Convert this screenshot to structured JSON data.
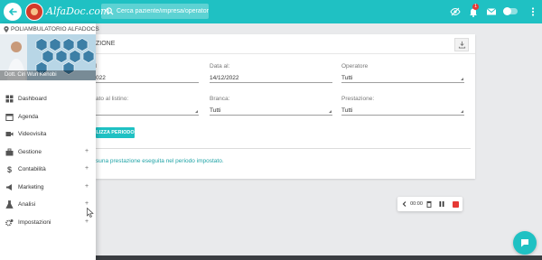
{
  "topbar": {
    "brand": "AlfaDoc.com",
    "search_placeholder": "Cerca paziente/impresa/operatore",
    "notifications_count": "1",
    "colors": {
      "accent": "#1fc1c3",
      "badge": "#e53935"
    }
  },
  "sidebar": {
    "clinic": "POLIAMBULATORIO ALFADOCS",
    "doctor": "Dott. Ciri Wuri Kenobi",
    "items": [
      {
        "label": "Dashboard",
        "icon": "dashboard-icon",
        "expandable": false
      },
      {
        "label": "Agenda",
        "icon": "calendar-icon",
        "expandable": false
      },
      {
        "label": "Videovisita",
        "icon": "video-icon",
        "expandable": false
      },
      {
        "label": "Gestione",
        "icon": "toolbox-icon",
        "expandable": true,
        "plus": "+"
      },
      {
        "label": "Contabilità",
        "icon": "dollar-icon",
        "expandable": true,
        "plus": "+"
      },
      {
        "label": "Marketing",
        "icon": "megaphone-icon",
        "expandable": true,
        "plus": "+"
      },
      {
        "label": "Analisi",
        "icon": "flask-icon",
        "expandable": true,
        "plus": "+"
      },
      {
        "label": "Impostazioni",
        "icon": "gears-icon",
        "expandable": true,
        "plus": "+"
      }
    ]
  },
  "main": {
    "title": "ZIONE",
    "filters": {
      "dal": {
        "label": "l",
        "value": "022"
      },
      "data_al": {
        "label": "Data al:",
        "value": "14/12/2022"
      },
      "operatore": {
        "label": "Operatore",
        "value": "Tutti"
      },
      "listino": {
        "label": "ato al listino:",
        "value": ""
      },
      "branca": {
        "label": "Branca:",
        "value": "Tutti"
      },
      "prestazione": {
        "label": "Prestazione:",
        "value": "Tutti"
      }
    },
    "apply_button": "LIZZA PERIODO",
    "empty_message": "suna prestazione eseguita nel periodo impostato."
  },
  "recorder": {
    "time": "00:00"
  }
}
